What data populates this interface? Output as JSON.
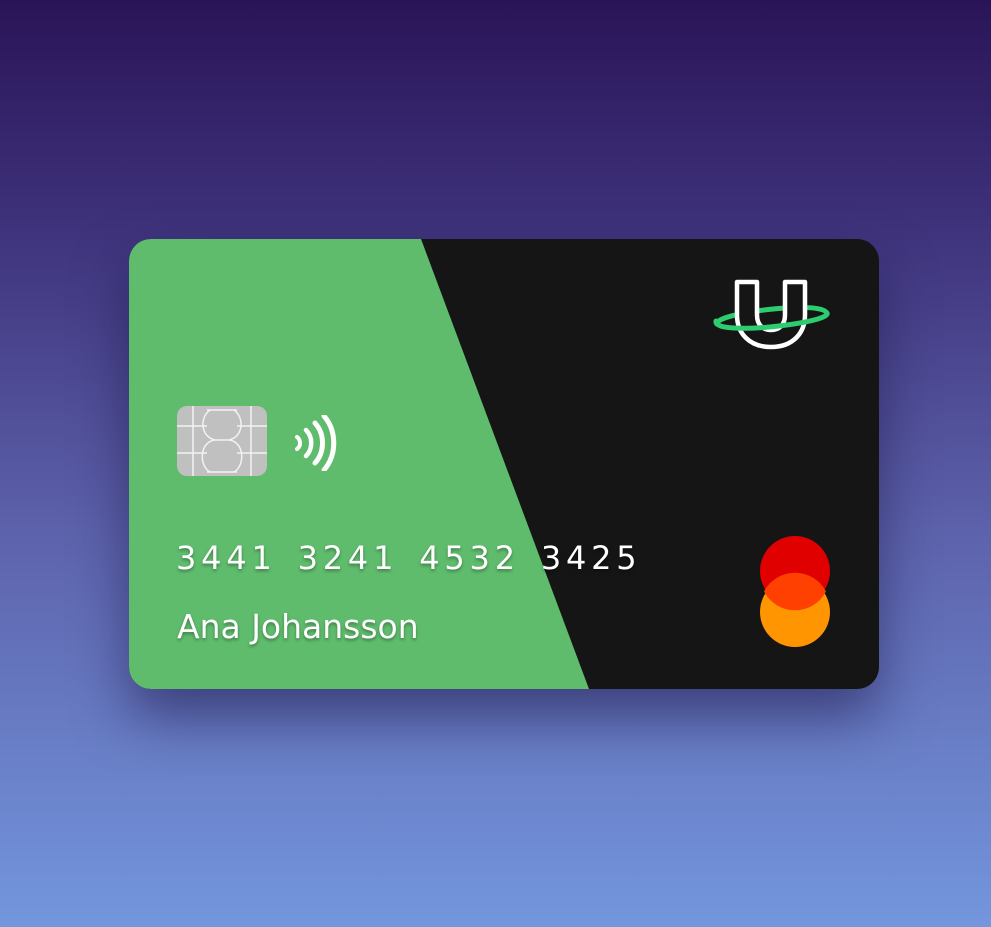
{
  "card": {
    "number": "3441 3241 4532 3425",
    "holder_name": "Ana Johansson",
    "colors": {
      "panel_green": "#5fbc6d",
      "card_black": "#151515",
      "logo_ring": "#2ecc71",
      "network_red": "#e00000",
      "network_orange": "#ff9500",
      "network_overlap": "#ff4000"
    }
  },
  "icons": {
    "brand_logo": "u-ring-logo-icon",
    "chip": "emv-chip-icon",
    "contactless": "contactless-icon",
    "network": "mastercard-icon"
  }
}
